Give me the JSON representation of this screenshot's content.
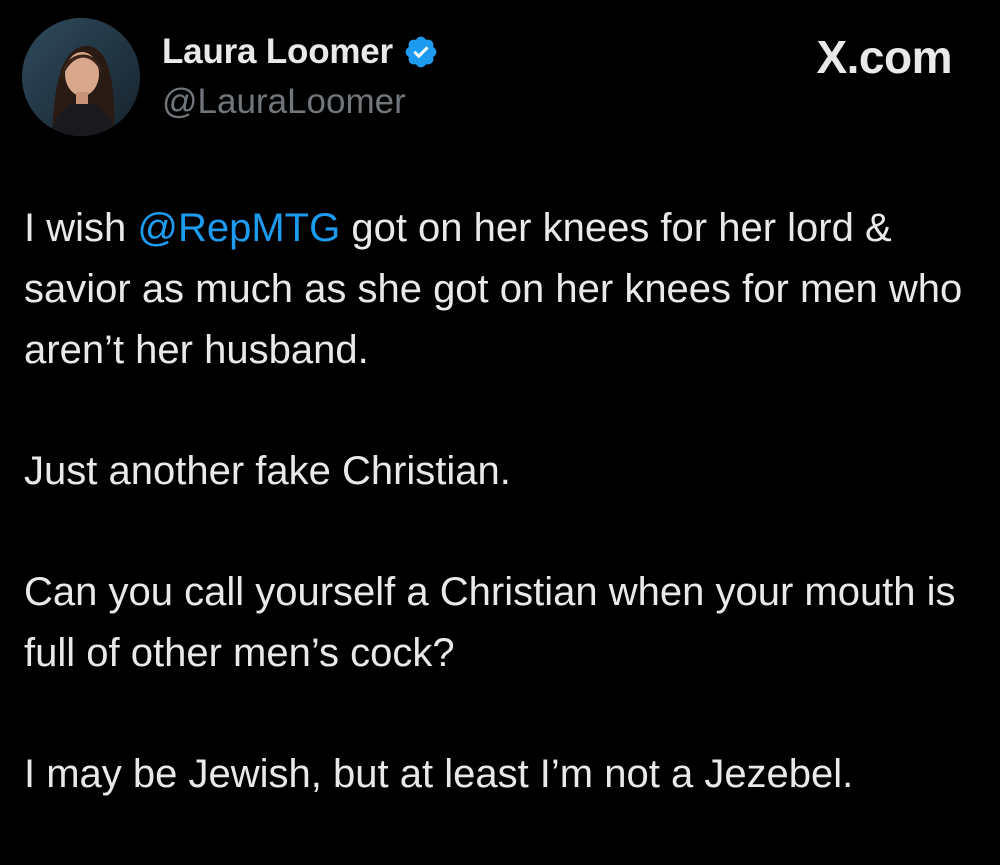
{
  "author": {
    "display_name": "Laura Loomer",
    "handle": "@LauraLoomer",
    "verified_icon": "verified-badge-icon",
    "verified_color": "#1d9bf0"
  },
  "site_label": "X.com",
  "tweet": {
    "p1_mention": "@RepMTG",
    "p1_pre": "I wish ",
    "p1_post": " got on her knees for her lord & savior as much as she got on her knees for men who aren’t her husband.",
    "p2": "Just another fake Christian.",
    "p3": "Can you call yourself a Christian when your mouth is full of other men’s cock?",
    "p4": "I may be Jewish, but at least I’m not a Jezebel."
  },
  "colors": {
    "background": "#000000",
    "text": "#e7e9ea",
    "secondary_text": "#71767b",
    "link": "#1d9bf0"
  }
}
